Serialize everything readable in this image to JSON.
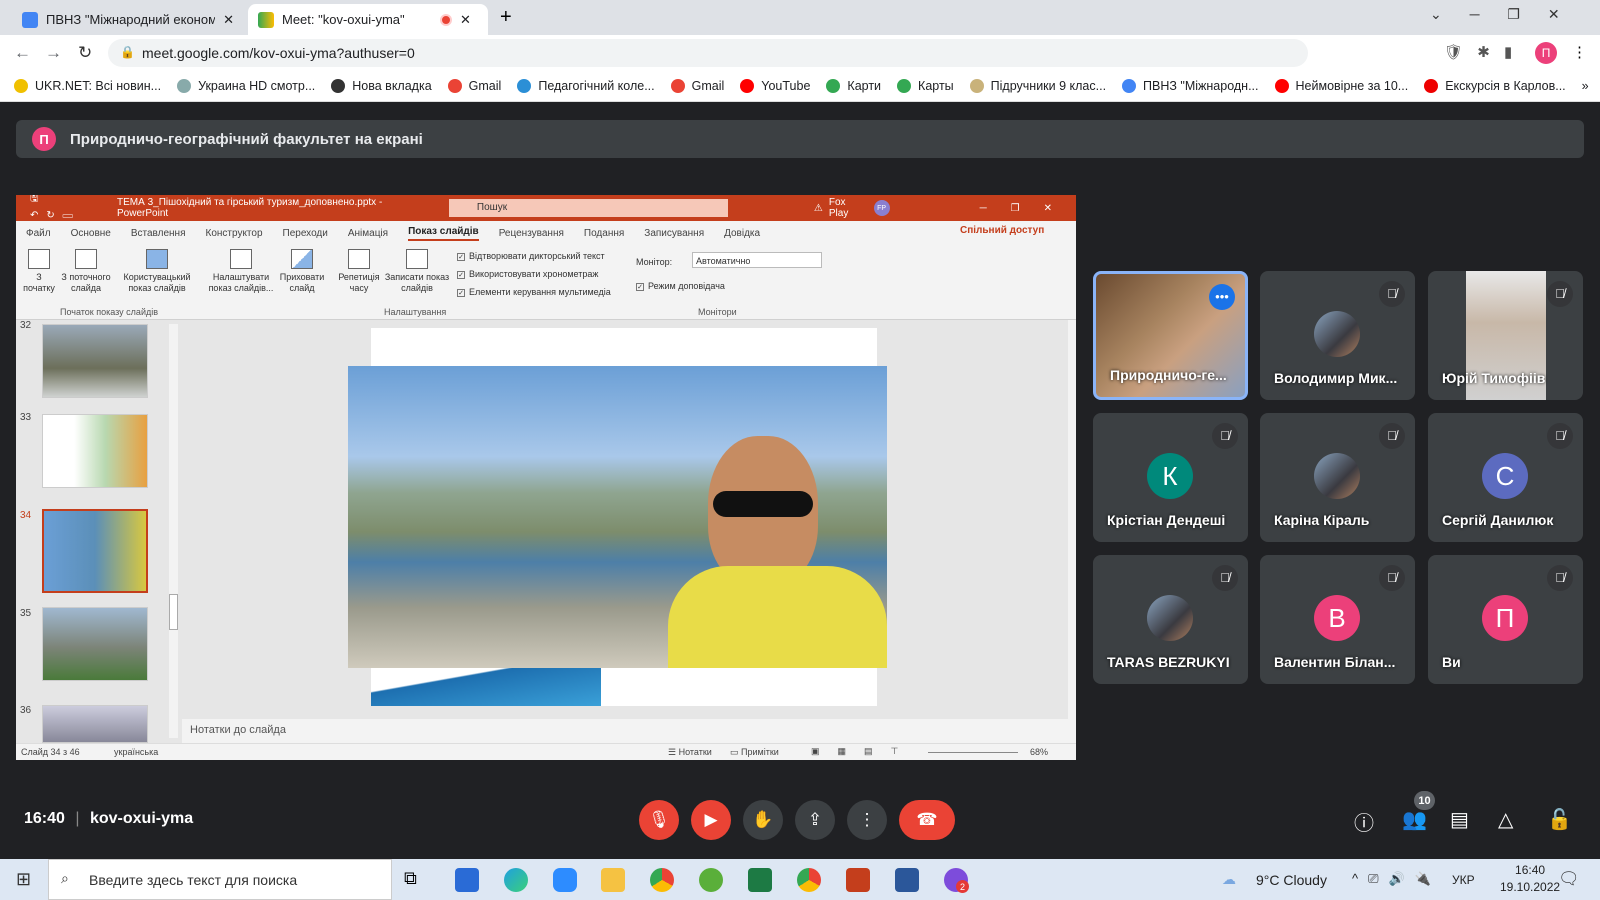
{
  "browser": {
    "tabs": [
      {
        "label": "ПВНЗ \"Міжнародний економіко",
        "icon": "calendar-icon"
      },
      {
        "label": "Meet: \"kov-oxui-yma\"",
        "icon": "meet-icon",
        "recording": true
      }
    ],
    "url": "meet.google.com/kov-oxui-yma?authuser=0",
    "bookmarks": [
      {
        "label": "UKR.NET: Всі новин...",
        "color": "#f0c000"
      },
      {
        "label": "Украина HD смотр...",
        "color": "#8aa"
      },
      {
        "label": "Нова вкладка",
        "color": "#333"
      },
      {
        "label": "Gmail",
        "color": "#ea4335"
      },
      {
        "label": "Педагогічний коле...",
        "color": "#2b8fd6"
      },
      {
        "label": "Gmail",
        "color": "#ea4335"
      },
      {
        "label": "YouTube",
        "color": "#f00"
      },
      {
        "label": "Карти",
        "color": "#34a853"
      },
      {
        "label": "Карты",
        "color": "#34a853"
      },
      {
        "label": "Підручники 9 клас...",
        "color": "#c9b27a"
      },
      {
        "label": "ПВНЗ \"Міжнародн...",
        "color": "#4285f4"
      },
      {
        "label": "Неймовірне за 10...",
        "color": "#f00"
      },
      {
        "label": "Екскурсія в Карлов...",
        "color": "#e00"
      }
    ],
    "profile_initial": "П"
  },
  "banner": {
    "initial": "П",
    "text": "Природничо-географічний факультет на екрані"
  },
  "ppt": {
    "title": "ТЕМА 3_Пішохідний та гірський туризм_доповнено.pptx - PowerPoint",
    "search": "Пошук",
    "user": "Fox Play",
    "user_initials": "FP",
    "tabs": [
      "Файл",
      "Основне",
      "Вставлення",
      "Конструктор",
      "Переходи",
      "Анімація",
      "Показ слайдів",
      "Рецензування",
      "Подання",
      "Записування",
      "Довідка"
    ],
    "active_tab": "Показ слайдів",
    "share": "Спільний доступ",
    "buttons": [
      "З початку",
      "З поточного слайда",
      "Користувацький показ слайдів",
      "Налаштувати показ слайдів...",
      "Приховати слайд",
      "Репетиція часу",
      "Записати показ слайдів"
    ],
    "checks": [
      "Відтворювати дикторський текст",
      "Використовувати хронометраж",
      "Елементи керування мультимедіа"
    ],
    "monitor_label": "Монітор:",
    "monitor_value": "Автоматично",
    "presenter_view": "Режим доповідача",
    "groups": [
      "Початок показу слайдів",
      "Налаштування",
      "Монітори"
    ],
    "slides": [
      "32",
      "33",
      "34",
      "35",
      "36"
    ],
    "current_slide": "34",
    "notes": "Нотатки до слайда",
    "status": {
      "slide": "Слайд 34 з 46",
      "lang": "українська",
      "notes": "Нотатки",
      "comments": "Примітки",
      "zoom": "68%"
    }
  },
  "participants": [
    {
      "name": "Природничо-ге...",
      "speaking": true,
      "video": true
    },
    {
      "name": "Володимир Мик...",
      "photo": true
    },
    {
      "name": "Юрій Тимофіів",
      "video": true
    },
    {
      "name": "Крістіан Дендеші",
      "initial": "К",
      "color": "#00897b"
    },
    {
      "name": "Каріна Кіраль",
      "photo": true
    },
    {
      "name": "Сергій Данилюк",
      "initial": "С",
      "color": "#5c6bc0"
    },
    {
      "name": "TARAS BEZRUKYI",
      "photo": true
    },
    {
      "name": "Валентин Білан...",
      "initial": "В",
      "color": "#ec407a"
    },
    {
      "name": "Ви",
      "initial": "П",
      "color": "#ec407a"
    }
  ],
  "meet": {
    "time": "16:40",
    "code": "kov-oxui-yma",
    "people_count": "10"
  },
  "taskbar": {
    "search": "Введите здесь текст для поиска",
    "weather": "9°C  Cloudy",
    "lang": "УКР",
    "time": "16:40",
    "date": "19.10.2022",
    "badge": "2"
  }
}
